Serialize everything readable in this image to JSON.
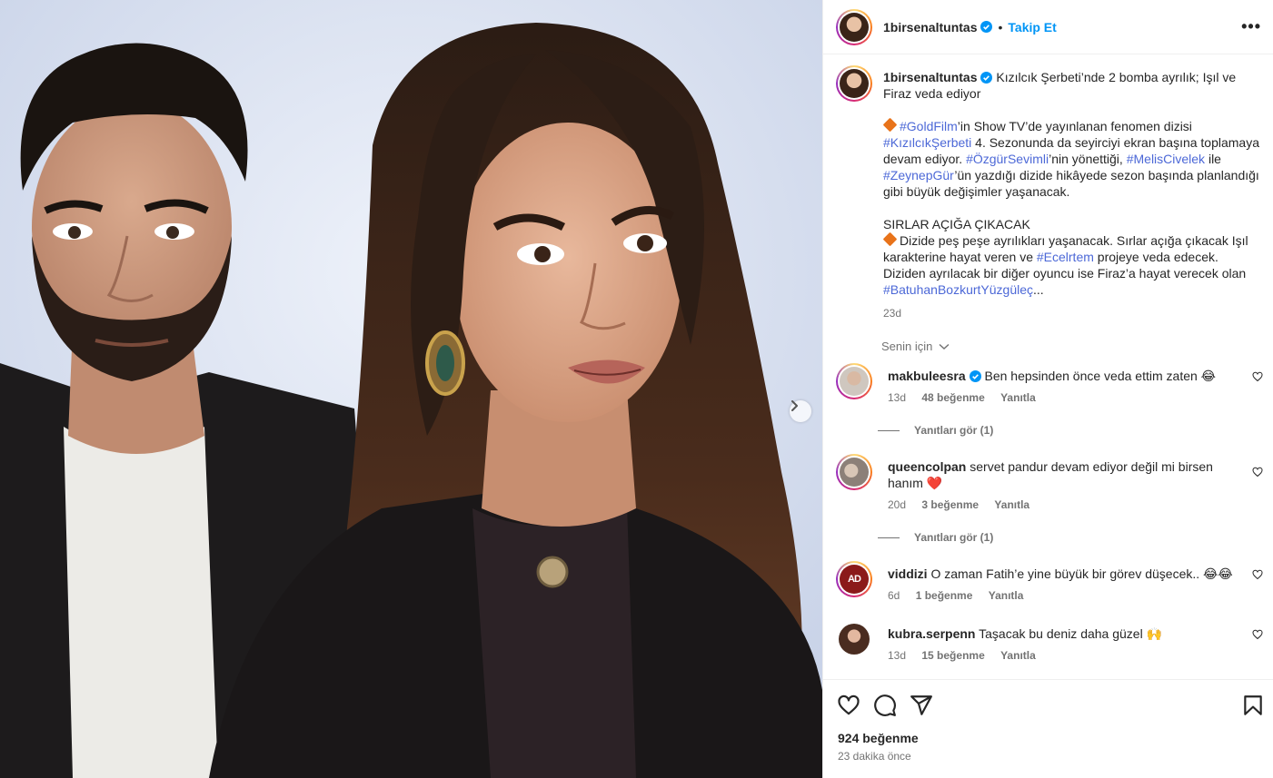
{
  "post": {
    "username": "1birsenaltuntas",
    "follow_label": "Takip Et",
    "more_label": "•••",
    "caption_title": "Kızılcık Şerbeti’nde 2 bomba ayrılık; Işıl ve Firaz veda ediyor",
    "caption_p1": {
      "tag1": "#GoldFilm",
      "t1": "’in Show TV’de yayınlanan fenomen dizisi ",
      "tag2": "#KızılcıkŞerbeti",
      "t2": " 4. Sezonunda da seyirciyi ekran başına toplamaya devam ediyor. ",
      "tag3": "#ÖzgürSevimli",
      "t3": "’nin yönettiği, ",
      "tag4": "#MelisCivelek",
      "t4": " ile ",
      "tag5": "#ZeynepGür",
      "t5": "’ün yazdığı dizide hikâyede sezon başında planlandığı gibi büyük değişimler yaşanacak."
    },
    "caption_heading": "SIRLAR AÇIĞA ÇIKACAK",
    "caption_p2": {
      "t1": "Dizide peş peşe ayrılıkları yaşanacak. Sırlar açığa çıkacak Işıl karakterine hayat veren ve ",
      "tag1": "#Ecelrtem",
      "t2": " projeye veda edecek. Diziden ayrılacak bir diğer oyuncu ise Firaz’a hayat verecek olan ",
      "tag2": "#BatuhanBozkurtYüzgüleç",
      "t3": "..."
    },
    "caption_time": "23d",
    "for_you_label": "Senin için",
    "likes": "924 beğenme",
    "posted_ago": "23 dakika önce"
  },
  "comments": [
    {
      "user": "makbuleesra",
      "verified": true,
      "text": "Ben hepsinden önce veda ettim zaten 😂",
      "time": "13d",
      "likes": "48 beğenme",
      "reply": "Yanıtla",
      "view_replies": "Yanıtları gör (1)"
    },
    {
      "user": "queencolpan",
      "verified": false,
      "text": "servet pandur devam ediyor değil mi birsen hanım ❤️",
      "time": "20d",
      "likes": "3 beğenme",
      "reply": "Yanıtla",
      "view_replies": "Yanıtları gör (1)"
    },
    {
      "user": "viddizi",
      "verified": false,
      "text": "O zaman Fatih’e yine büyük bir görev düşecek.. 😂😂",
      "time": "6d",
      "likes": "1 beğenme",
      "reply": "Yanıtla"
    },
    {
      "user": "kubra.serpenn",
      "verified": false,
      "text": "Taşacak bu deniz daha güzel 🙌",
      "time": "13d",
      "likes": "15 beğenme",
      "reply": "Yanıtla"
    }
  ],
  "icons": {
    "like": "heart-icon",
    "comment": "comment-icon",
    "share": "share-icon",
    "save": "bookmark-icon",
    "next": "chevron-right-icon",
    "verified": "verified-badge-icon"
  },
  "colors": {
    "link_blue": "#0095f6",
    "hashtag": "#4c68d7",
    "verified": "#0095f6",
    "muted": "#737373"
  }
}
